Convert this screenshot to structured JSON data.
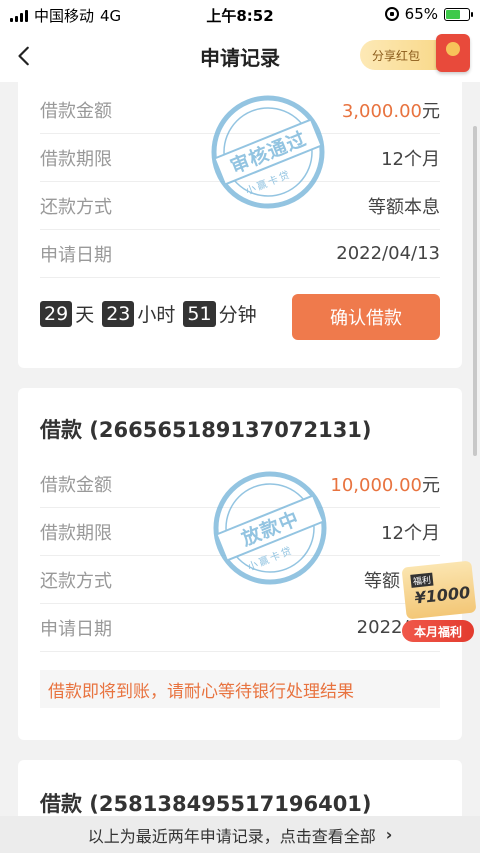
{
  "status": {
    "carrier": "中国移动",
    "network": "4G",
    "time": "上午8:52",
    "battery": "65%"
  },
  "nav": {
    "title": "申请记录",
    "share_label": "分享红包"
  },
  "cards": [
    {
      "rows": [
        {
          "label": "借款金额",
          "amount": "3,000.00",
          "unit": "元"
        },
        {
          "label": "借款期限",
          "value": "12个月"
        },
        {
          "label": "还款方式",
          "value": "等额本息"
        },
        {
          "label": "申请日期",
          "value": "2022/04/13"
        }
      ],
      "stamp": {
        "main": "审核通过",
        "sub": "小赢卡贷"
      },
      "timer": {
        "days": "29",
        "days_unit": "天",
        "hours": "23",
        "hours_unit": "小时",
        "minutes": "51",
        "minutes_unit": "分钟"
      },
      "action": "确认借款"
    },
    {
      "title": "借款 (266565189137072131)",
      "rows": [
        {
          "label": "借款金额",
          "amount": "10,000.00",
          "unit": "元"
        },
        {
          "label": "借款期限",
          "value": "12个月"
        },
        {
          "label": "还款方式",
          "value": "等额"
        },
        {
          "label": "申请日期",
          "value": "2022/0"
        }
      ],
      "stamp": {
        "main": "放款中",
        "sub": "小赢卡贷"
      },
      "notice": "借款即将到账，请耐心等待银行处理结果"
    },
    {
      "title": "借款 (258138495517196401)"
    }
  ],
  "welfare": {
    "tag": "福利",
    "amount": "¥1000",
    "button": "本月福利"
  },
  "footer": {
    "text": "以上为最近两年申请记录，点击查看全部",
    "chevron": "›"
  },
  "colors": {
    "accent": "#ef7a4c",
    "amount": "#e8733f",
    "stamp": "#6fb1d8"
  }
}
